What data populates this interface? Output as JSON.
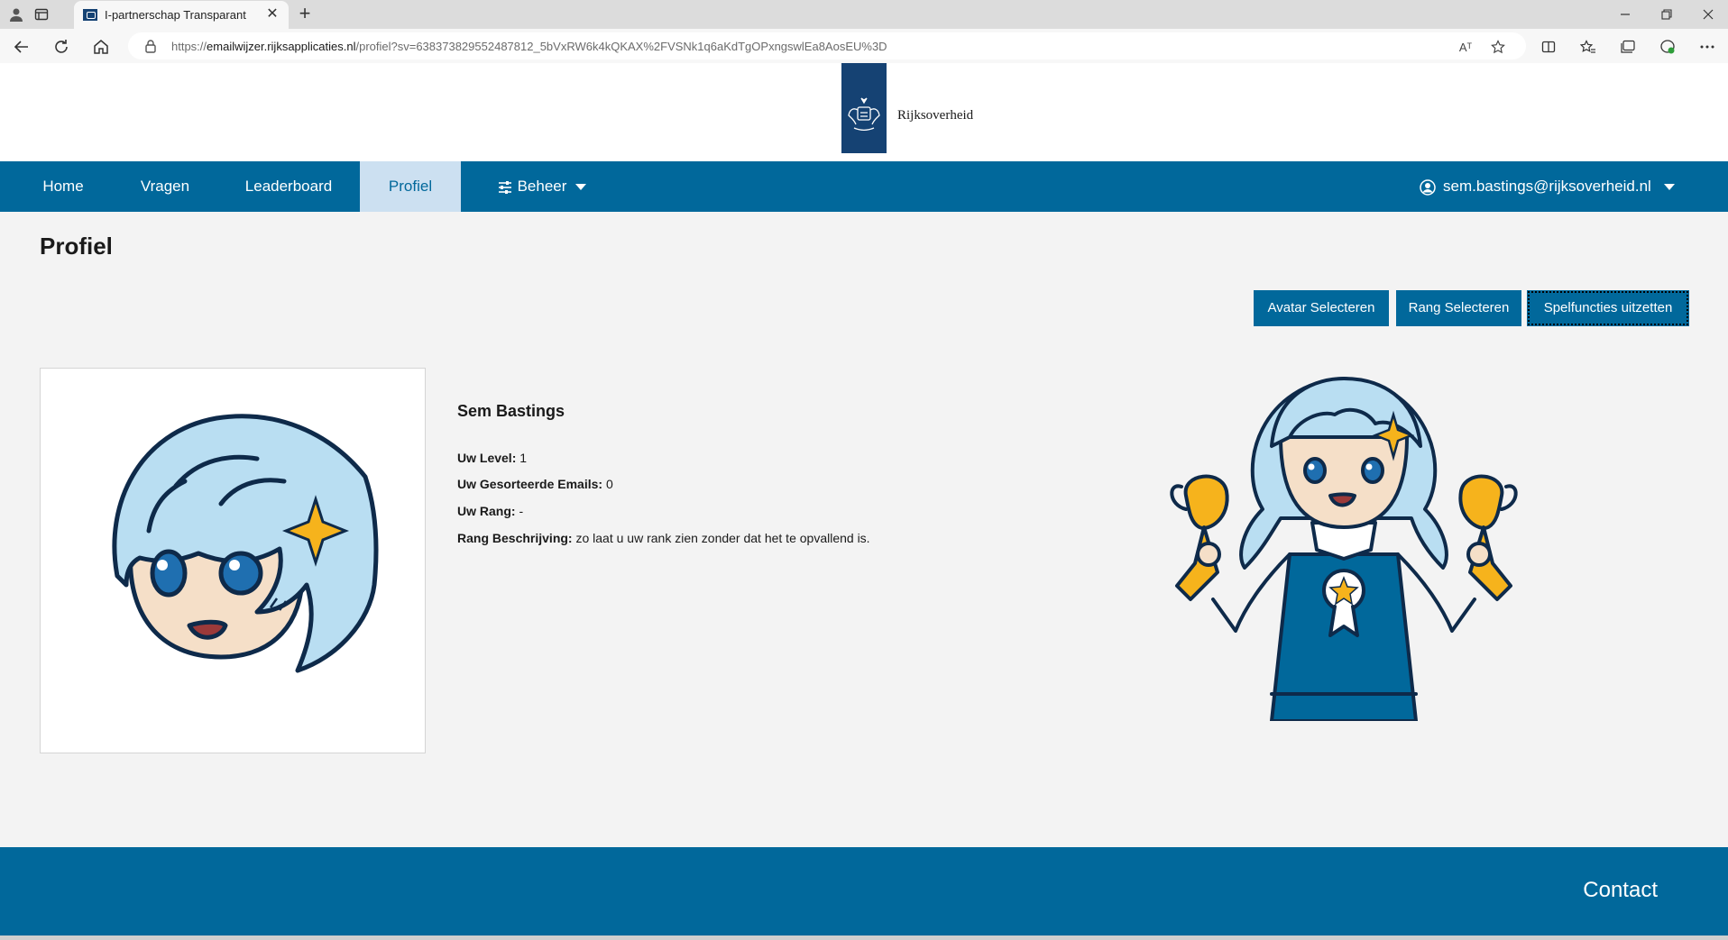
{
  "browser": {
    "tab_title": "I-partnerschap Transparant",
    "url_prefix": "https://",
    "url_host": "emailwijzer.rijksapplicaties.nl",
    "url_path": "/profiel?sv=638373829552487812_5bVxRW6k4kQKAX%2FVSNk1q6aKdTgOPxngswlEa8AosEU%3D",
    "read_aloud_label": "Aᵀ"
  },
  "site": {
    "logo_text": "Rijksoverheid"
  },
  "nav": {
    "items": [
      {
        "label": "Home"
      },
      {
        "label": "Vragen"
      },
      {
        "label": "Leaderboard"
      },
      {
        "label": "Profiel"
      },
      {
        "label": "Beheer"
      }
    ],
    "user_email": "sem.bastings@rijksoverheid.nl"
  },
  "page": {
    "title": "Profiel",
    "buttons": {
      "avatar": "Avatar Selecteren",
      "rang": "Rang Selecteren",
      "spelfuncties": "Spelfuncties uitzetten"
    }
  },
  "profile": {
    "name": "Sem Bastings",
    "fields": [
      {
        "label": "Uw Level:",
        "value": "1"
      },
      {
        "label": "Uw Gesorteerde Emails:",
        "value": "0"
      },
      {
        "label": "Uw Rang:",
        "value": "-"
      },
      {
        "label": "Rang Beschrijving:",
        "value": "zo laat u uw rank zien zonder dat het te opvallend is."
      }
    ]
  },
  "footer": {
    "contact": "Contact"
  },
  "colors": {
    "brand_blue": "#01689b",
    "logo_blue": "#154273",
    "active_tab": "#cce0f1",
    "hair_blue": "#b9def2",
    "skin": "#f5dfc8",
    "gold": "#f6b31c",
    "outline": "#0e2a4a"
  },
  "icons": {
    "profile": "person-circle-icon",
    "beheer": "sliders-icon"
  }
}
